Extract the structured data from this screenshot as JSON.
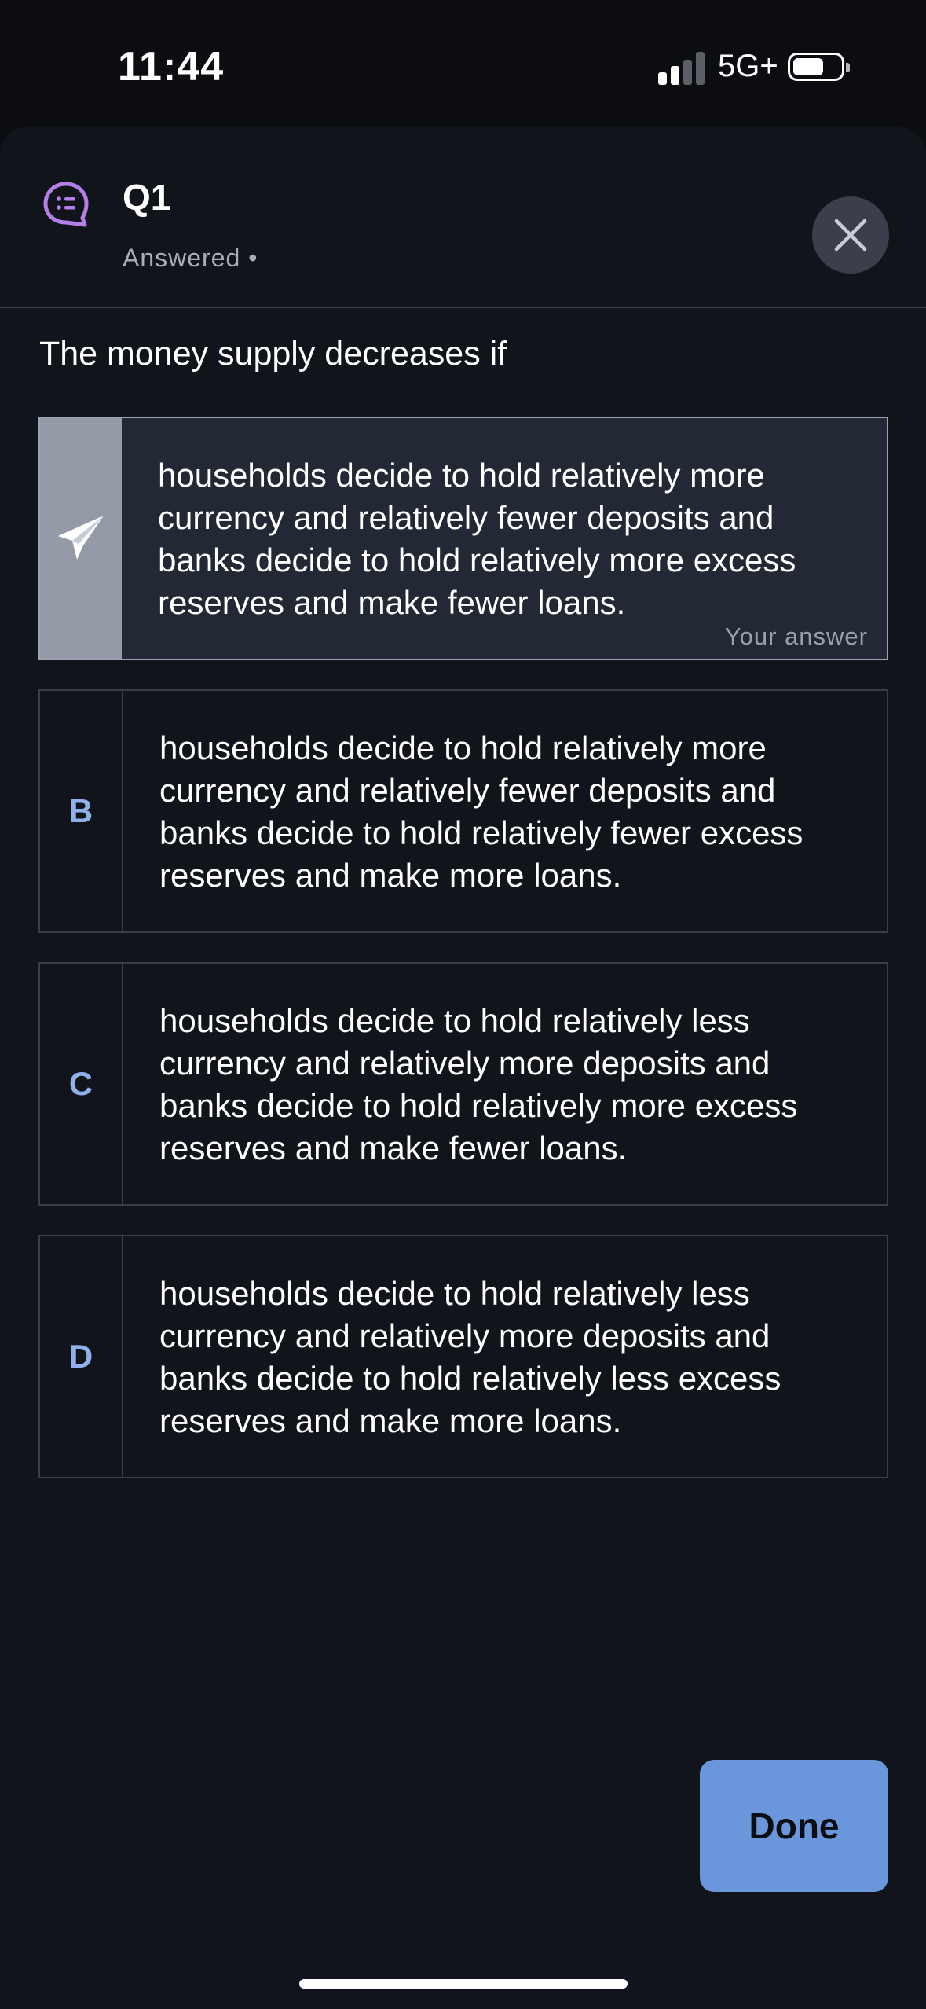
{
  "status_bar": {
    "time": "11:44",
    "network": "5G+",
    "signal_bars_active": 2,
    "signal_bars_total": 4,
    "battery_level": 0.55
  },
  "header": {
    "icon": "list-chat-bubble-icon",
    "title": "Q1",
    "status": "Answered  •",
    "close_icon": "close-icon"
  },
  "question": "The money supply decreases if",
  "options": [
    {
      "letter": "",
      "icon": "paper-plane-icon",
      "text": "households decide to hold relatively more currency and relatively fewer deposits and banks decide to hold relatively more excess reserves and make fewer loans.",
      "selected": true,
      "tag": "Your answer"
    },
    {
      "letter": "B",
      "text": "households decide to hold relatively more currency and relatively fewer deposits and banks decide to hold relatively fewer excess reserves and make more loans.",
      "selected": false
    },
    {
      "letter": "C",
      "text": "households decide to hold relatively less currency and relatively more deposits and banks decide to hold relatively more excess reserves and make fewer loans.",
      "selected": false
    },
    {
      "letter": "D",
      "text": "households decide to hold relatively less currency and relatively more deposits and banks decide to hold relatively less excess reserves and make more loans.",
      "selected": false
    }
  ],
  "done_label": "Done",
  "colors": {
    "background": "#12141b",
    "accent": "#6a96dc",
    "letter": "#8fb0e8",
    "icon_purple": "#b47fe6"
  }
}
